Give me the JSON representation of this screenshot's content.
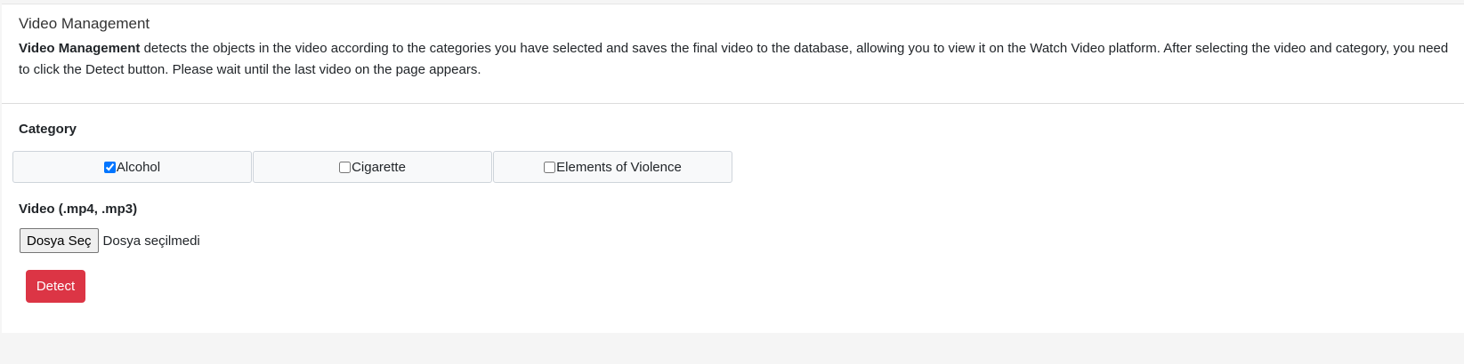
{
  "header": {
    "title": "Video Management",
    "description_bold": "Video Management",
    "description_rest": " detects the objects in the video according to the categories you have selected and saves the final video to the database, allowing you to view it on the Watch Video platform. After selecting the video and category, you need to click the Detect button. Please wait until the last video on the page appears."
  },
  "form": {
    "category_label": "Category",
    "categories": [
      {
        "label": "Alcohol",
        "checked": true
      },
      {
        "label": "Cigarette",
        "checked": false
      },
      {
        "label": "Elements of Violence",
        "checked": false
      }
    ],
    "video_label": "Video (.mp4, .mp3)",
    "file_button_label": "Dosya Seç",
    "file_status": "Dosya seçilmedi",
    "detect_label": "Detect"
  },
  "colors": {
    "detect_button": "#dc3545",
    "category_button_bg": "#f8f9fa"
  }
}
